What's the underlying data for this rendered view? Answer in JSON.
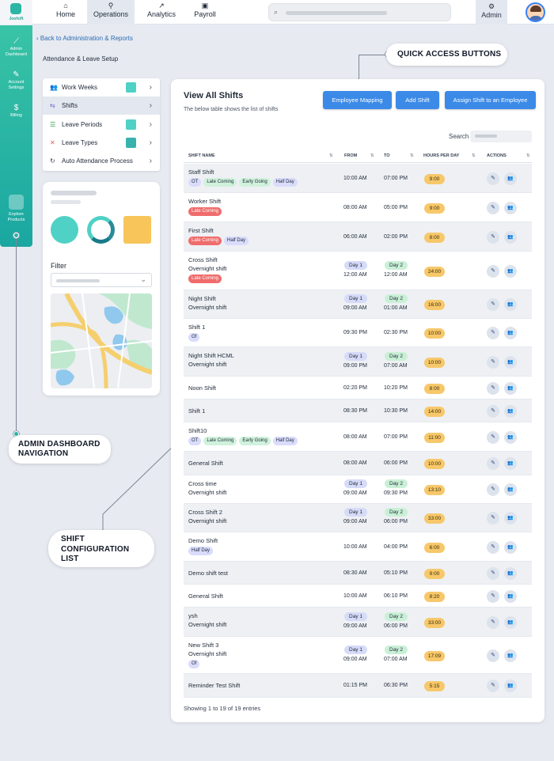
{
  "app": {
    "logo_text": "Joofsift"
  },
  "topnav": {
    "tabs": [
      {
        "label": "Home",
        "icon": "home-icon"
      },
      {
        "label": "Operations",
        "icon": "pin-icon"
      },
      {
        "label": "Analytics",
        "icon": "chart-icon"
      },
      {
        "label": "Payroll",
        "icon": "wallet-icon"
      }
    ],
    "admin_label": "Admin"
  },
  "sidebar": {
    "items": [
      {
        "label": "Admin Dashboard",
        "icon": "line-chart-icon"
      },
      {
        "label": "Account Settings",
        "icon": "wrench-icon"
      },
      {
        "label": "Billing",
        "icon": "dollar-icon"
      },
      {
        "label": "Explore Products",
        "icon": "grid-icon"
      }
    ]
  },
  "callouts": {
    "quick": "QUICK ACCESS BUTTONS",
    "admin_nav_1": "ADMIN DASHBOARD",
    "admin_nav_2": "NAVIGATION",
    "shift_1": "SHIFT",
    "shift_2": "CONFIGURATION",
    "shift_3": "LIST"
  },
  "breadcrumb": {
    "back": "Back to Administration & Reports"
  },
  "setup_title": "Attendance & Leave Setup",
  "setup_menu": [
    {
      "label": "Work Weeks",
      "icon": "people-icon",
      "color": "#4fd1c5"
    },
    {
      "label": "Shifts",
      "icon": "shift-icon"
    },
    {
      "label": "Leave Periods",
      "icon": "list-icon",
      "color": "#4fd1c5"
    },
    {
      "label": "Leave Types",
      "icon": "x-icon",
      "color": "#38b2ac"
    },
    {
      "label": "Auto Attendance Process",
      "icon": "sync-icon"
    }
  ],
  "filter": {
    "label": "Filter"
  },
  "main": {
    "title": "View All Shifts",
    "subtitle": "The below table shows the list of shifts",
    "buttons": {
      "employee_mapping": "Employee Mapping",
      "add_shift": "Add Shift",
      "assign_shift": "Assign Shift to an Employee"
    },
    "search_label": "Search",
    "columns": {
      "name": "SHIFT NAME",
      "from": "FROM",
      "to": "TO",
      "hours": "HOURS PER DAY",
      "actions": "ACTIONS"
    },
    "footer": "Showing 1 to 19 of 19 entries"
  },
  "shifts": [
    {
      "name": "Staff Shift",
      "tags": [
        "OT",
        "Late Coming",
        "Early Going",
        "Half Day"
      ],
      "from": "10:00 AM",
      "to": "07:00 PM",
      "hours": "9:00"
    },
    {
      "name": "Worker Shift",
      "tags": [
        "Late Coming"
      ],
      "from": "08:00 AM",
      "to": "05:00 PM",
      "hours": "9:00"
    },
    {
      "name": "First Shift",
      "tags": [
        "Late Coming",
        "Half Day"
      ],
      "from": "06:00 AM",
      "to": "02:00 PM",
      "hours": "8:00"
    },
    {
      "name": "Cross Shift",
      "sub": "Overnight shift",
      "tags": [
        "Late Coming"
      ],
      "from_day": "Day 1",
      "from": "12:00 AM",
      "to_day": "Day 2",
      "to": "12:00 AM",
      "hours": "24:00"
    },
    {
      "name": "Night Shift",
      "sub": "Overnight shift",
      "from_day": "Day 1",
      "from": "09:00 AM",
      "to_day": "Day 2",
      "to": "01:00 AM",
      "hours": "16:00"
    },
    {
      "name": "Shift 1",
      "tags": [
        "Of"
      ],
      "from": "09:30 PM",
      "to": "02:30 PM",
      "hours": "10:00"
    },
    {
      "name": "Night Shift HCML",
      "sub": "Overnight shift",
      "from_day": "Day 1",
      "from": "09:00 PM",
      "to_day": "Day 2",
      "to": "07:00 AM",
      "hours": "10:00"
    },
    {
      "name": "Noon Shift",
      "from": "02:20 PM",
      "to": "10:20 PM",
      "hours": "8:00"
    },
    {
      "name": "Shift 1",
      "from": "08:30 PM",
      "to": "10:30 PM",
      "hours": "14:00"
    },
    {
      "name": "Shift10",
      "tags": [
        "OT",
        "Late Coming",
        "Early Going",
        "Half Day"
      ],
      "from": "08:00 AM",
      "to": "07:00 PM",
      "hours": "11:00"
    },
    {
      "name": "General Shift",
      "from": "08:00 AM",
      "to": "06:00 PM",
      "hours": "10:00"
    },
    {
      "name": "Cross time",
      "sub": "Overnight shift",
      "from_day": "Day 1",
      "from": "09:00 AM",
      "to_day": "Day 2",
      "to": "09:30 PM",
      "hours": "13:10"
    },
    {
      "name": "Cross Shift 2",
      "sub": "Overnight shift",
      "from_day": "Day 1",
      "from": "09:00 AM",
      "to_day": "Day 2",
      "to": "06:00 PM",
      "hours": "33:00"
    },
    {
      "name": "Demo Shift",
      "tags": [
        "Half Day"
      ],
      "from": "10:00 AM",
      "to": "04:00 PM",
      "hours": "6:00"
    },
    {
      "name": "Demo shift test",
      "from": "08:30 AM",
      "to": "05:10 PM",
      "hours": "9:00"
    },
    {
      "name": "General Shift",
      "from": "10:00 AM",
      "to": "06:10 PM",
      "hours": "8:20"
    },
    {
      "name": "ysh",
      "sub": "Overnight shift",
      "from_day": "Day 1",
      "from": "09:00 AM",
      "to_day": "Day 2",
      "to": "06:00 PM",
      "hours": "33:00"
    },
    {
      "name": "New Shift 3",
      "sub": "Overnight shift",
      "tags": [
        "Of"
      ],
      "from_day": "Day 1",
      "from": "09:00 AM",
      "to_day": "Day 2",
      "to": "07:00 AM",
      "hours": "17:09"
    },
    {
      "name": "Reminder Test Shift",
      "from": "01:15 PM",
      "to": "06:30 PM",
      "hours": "5:15"
    }
  ]
}
